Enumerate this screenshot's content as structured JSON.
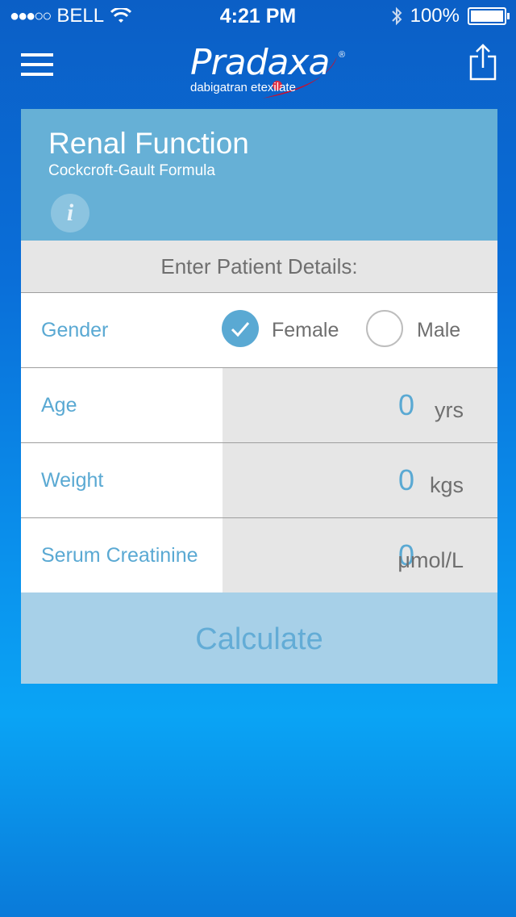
{
  "status_bar": {
    "carrier": "BELL",
    "time": "4:21 PM",
    "battery": "100%"
  },
  "nav": {
    "brand": "Pradaxa",
    "brand_mark": "®",
    "generic_name": "dabigatran etexilate"
  },
  "header": {
    "title": "Renal Function",
    "subtitle": "Cockcroft-Gault Formula",
    "info": "i"
  },
  "form": {
    "section_label": "Enter Patient Details:",
    "gender": {
      "label": "Gender",
      "options": [
        "Female",
        "Male"
      ],
      "selected": "Female"
    },
    "age": {
      "label": "Age",
      "value": "0",
      "unit": "yrs"
    },
    "weight": {
      "label": "Weight",
      "value": "0",
      "unit": "kgs"
    },
    "creatinine": {
      "label": "Serum Creatinine",
      "value": "0",
      "unit": "μmol/L"
    },
    "calculate_label": "Calculate"
  },
  "colors": {
    "header_bg": "#66b0d6",
    "accent": "#5aa9d3",
    "button_bg": "#a7d0e8",
    "logo_swoosh": "#c8102e"
  }
}
